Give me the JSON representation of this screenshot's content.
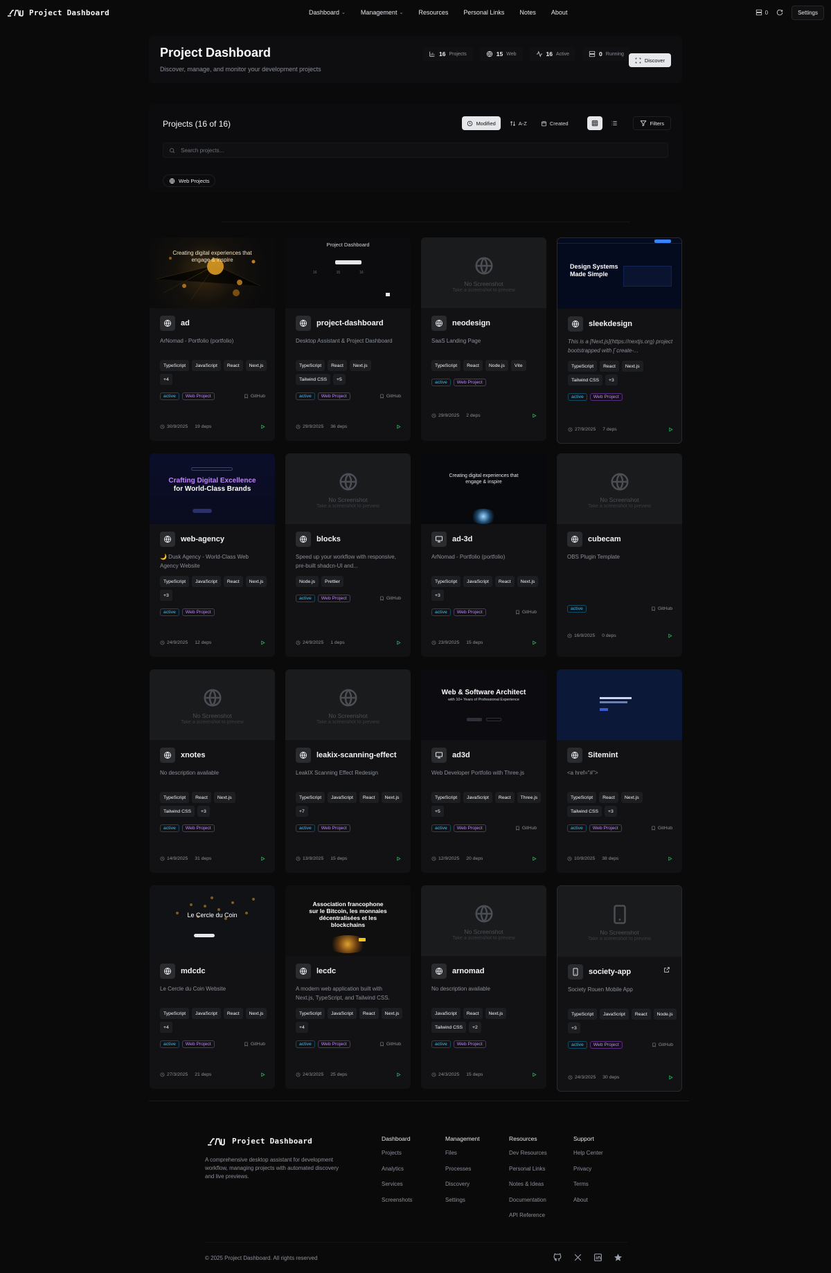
{
  "nav": {
    "brand": "Project Dashboard",
    "links": [
      {
        "label": "Dashboard",
        "dropdown": true
      },
      {
        "label": "Management",
        "dropdown": true
      },
      {
        "label": "Resources",
        "dropdown": false
      },
      {
        "label": "Personal Links",
        "dropdown": false
      },
      {
        "label": "Notes",
        "dropdown": false
      },
      {
        "label": "About",
        "dropdown": false
      }
    ],
    "counter": "0",
    "settings_label": "Settings"
  },
  "header": {
    "title": "Project Dashboard",
    "subtitle": "Discover, manage, and monitor your development projects",
    "stats": [
      {
        "value": "16",
        "label": "Projects",
        "icon": "bar-chart-icon"
      },
      {
        "value": "15",
        "label": "Web",
        "icon": "globe-icon"
      },
      {
        "value": "16",
        "label": "Active",
        "icon": "activity-icon"
      },
      {
        "value": "0",
        "label": "Running",
        "icon": "server-icon"
      }
    ],
    "discover_label": "Discover"
  },
  "projects": {
    "title": "Projects (16 of 16)",
    "sort": [
      {
        "label": "Modified",
        "active": true
      },
      {
        "label": "A-Z",
        "active": false
      },
      {
        "label": "Created",
        "active": false
      }
    ],
    "filters_label": "Filters",
    "search_placeholder": "Search projects...",
    "chip_label": "Web Projects"
  },
  "cards": [
    {
      "name": "ad",
      "icon": "globe-icon",
      "thumb": "orbs",
      "desc": "ArNomad - Portfolio (portfolio)",
      "tags": [
        "TypeScript",
        "JavaScript",
        "React",
        "Next.js",
        "+4"
      ],
      "status": "active",
      "type": "Web Project",
      "github": "GitHub",
      "date": "30/9/2025",
      "deps": "19 deps"
    },
    {
      "name": "project-dashboard",
      "icon": "globe-icon",
      "thumb": "dash",
      "desc": "Desktop Assistant & Project Dashboard",
      "tags": [
        "TypeScript",
        "React",
        "Next.js",
        "Tailwind CSS",
        "+5"
      ],
      "status": "active",
      "type": "Web Project",
      "github": "GitHub",
      "date": "29/9/2025",
      "deps": "36 deps"
    },
    {
      "name": "neodesign",
      "icon": "globe-icon",
      "thumb": "none",
      "desc": "SaaS Landing Page",
      "tags": [
        "TypeScript",
        "React",
        "Node.js",
        "Vite"
      ],
      "status": "active",
      "type": "Web Project",
      "github": "",
      "date": "29/9/2025",
      "deps": "2 deps"
    },
    {
      "name": "sleekdesign",
      "icon": "globe-icon",
      "thumb": "navy",
      "desc": "This is a [Next.js](https://nextjs.org) project bootstrapped with [`create-...",
      "tags": [
        "TypeScript",
        "React",
        "Next.js",
        "Tailwind CSS",
        "+3"
      ],
      "status": "active",
      "type": "Web Project",
      "github": "",
      "date": "27/9/2025",
      "deps": "7 deps"
    },
    {
      "name": "web-agency",
      "icon": "globe-icon",
      "thumb": "agency",
      "desc": "🌙 Dusk Agency - World-Class Web Agency Website",
      "tags": [
        "TypeScript",
        "JavaScript",
        "React",
        "Next.js",
        "+3"
      ],
      "status": "active",
      "type": "Web Project",
      "github": "",
      "date": "24/9/2025",
      "deps": "12 deps"
    },
    {
      "name": "blocks",
      "icon": "globe-icon",
      "thumb": "none",
      "desc": "Speed up your workflow with responsive, pre-built shadcn-UI and...",
      "tags": [
        "Node.js",
        "Prettier"
      ],
      "status": "active",
      "type": "Web Project",
      "github": "GitHub",
      "date": "24/9/2025",
      "deps": "1 deps"
    },
    {
      "name": "ad-3d",
      "icon": "monitor-icon",
      "thumb": "cyan",
      "desc": "ArNomad - Portfolio (portfolio)",
      "tags": [
        "TypeScript",
        "JavaScript",
        "React",
        "Next.js",
        "+3"
      ],
      "status": "active",
      "type": "Web Project",
      "github": "GitHub",
      "date": "23/9/2025",
      "deps": "15 deps"
    },
    {
      "name": "cubecam",
      "icon": "globe-icon",
      "thumb": "none",
      "desc": "OBS Plugin Template",
      "tags": [],
      "status": "active",
      "type": "",
      "github": "GitHub",
      "date": "16/9/2025",
      "deps": "0 deps"
    },
    {
      "name": "xnotes",
      "icon": "globe-icon",
      "thumb": "none",
      "desc": "No description available",
      "tags": [
        "TypeScript",
        "React",
        "Next.js",
        "Tailwind CSS",
        "+3"
      ],
      "status": "active",
      "type": "Web Project",
      "github": "",
      "date": "14/9/2025",
      "deps": "31 deps"
    },
    {
      "name": "leakix-scanning-effect",
      "icon": "globe-icon",
      "thumb": "none",
      "desc": "LeakIX Scanning Effect Redesign",
      "tags": [
        "TypeScript",
        "JavaScript",
        "React",
        "Next.js",
        "+7"
      ],
      "status": "active",
      "type": "Web Project",
      "github": "",
      "date": "13/9/2025",
      "deps": "15 deps"
    },
    {
      "name": "ad3d",
      "icon": "monitor-icon",
      "thumb": "arch",
      "desc": "Web Developer Portfolio with Three.js",
      "tags": [
        "TypeScript",
        "JavaScript",
        "React",
        "Three.js",
        "+5"
      ],
      "status": "active",
      "type": "Web Project",
      "github": "GitHub",
      "date": "12/9/2025",
      "deps": "20 deps"
    },
    {
      "name": "Sitemint",
      "icon": "globe-icon",
      "thumb": "blue",
      "desc": "<a href=\"#\">",
      "tags": [
        "TypeScript",
        "React",
        "Next.js",
        "Tailwind CSS",
        "+3"
      ],
      "status": "active",
      "type": "Web Project",
      "github": "GitHub",
      "date": "10/9/2025",
      "deps": "38 deps"
    },
    {
      "name": "mdcdc",
      "icon": "globe-icon",
      "thumb": "coin",
      "desc": "Le Cercle du Coin Website",
      "tags": [
        "TypeScript",
        "JavaScript",
        "React",
        "Next.js",
        "+4"
      ],
      "status": "active",
      "type": "Web Project",
      "github": "GitHub",
      "date": "27/3/2025",
      "deps": "21 deps"
    },
    {
      "name": "lecdc",
      "icon": "globe-icon",
      "thumb": "btc",
      "desc": "A modern web application built with Next.js, TypeScript, and Tailwind CSS.",
      "tags": [
        "TypeScript",
        "JavaScript",
        "React",
        "Next.js",
        "+4"
      ],
      "status": "active",
      "type": "Web Project",
      "github": "GitHub",
      "date": "24/3/2025",
      "deps": "25 deps"
    },
    {
      "name": "arnomad",
      "icon": "globe-icon",
      "thumb": "none",
      "desc": "No description available",
      "tags": [
        "JavaScript",
        "React",
        "Next.js",
        "Tailwind CSS",
        "+2"
      ],
      "status": "active",
      "type": "Web Project",
      "github": "",
      "date": "24/3/2025",
      "deps": "15 deps"
    },
    {
      "name": "society-app",
      "icon": "phone-icon",
      "thumb": "phone",
      "desc": "Society Rouen Mobile App",
      "tags": [
        "TypeScript",
        "JavaScript",
        "React",
        "Node.js",
        "+3"
      ],
      "status": "active",
      "type": "Web Project",
      "github": "GitHub",
      "date": "24/3/2025",
      "deps": "30 deps",
      "external": true
    }
  ],
  "no_screenshot": {
    "title": "No Screenshot",
    "sub": "Take a screenshot to preview"
  },
  "thumbs": {
    "orbs": "Creating digital experiences that engage & inspire",
    "dash": "Project Dashboard",
    "navy": "Design Systems Made Simple",
    "agency_1": "Crafting Digital Excellence",
    "agency_2": "for World-Class Brands",
    "cyan": "Creating digital experiences that engage & inspire",
    "arch_1": "Web & Software Architect",
    "arch_2": "with 10+ Years of Professional Experience",
    "coin": "Le Cercle du Coin",
    "btc": "Association francophone sur le Bitcoin, les monnaies décentralisées et les blockchains"
  },
  "footer": {
    "brand": "Project Dashboard",
    "desc": "A comprehensive desktop assistant for development workflow, managing projects with automated discovery and live previews.",
    "columns": [
      {
        "head": "Dashboard",
        "links": [
          "Projects",
          "Analytics",
          "Services",
          "Screenshots"
        ]
      },
      {
        "head": "Management",
        "links": [
          "Files",
          "Processes",
          "Discovery",
          "Settings"
        ]
      },
      {
        "head": "Resources",
        "links": [
          "Dev Resources",
          "Personal Links",
          "Notes & Ideas",
          "Documentation",
          "API Reference"
        ]
      },
      {
        "head": "Support",
        "links": [
          "Help Center",
          "Privacy",
          "Terms",
          "About"
        ]
      }
    ],
    "copyright": "© 2025 Project Dashboard. All rights reserved",
    "socials": [
      "github-icon",
      "x-icon",
      "linkedin-icon",
      "star-icon"
    ]
  },
  "colors": {
    "bg": "#0a0a0b",
    "card": "#121214",
    "active": "#38bdf8",
    "web": "#c084fc",
    "run": "#22c55e"
  }
}
